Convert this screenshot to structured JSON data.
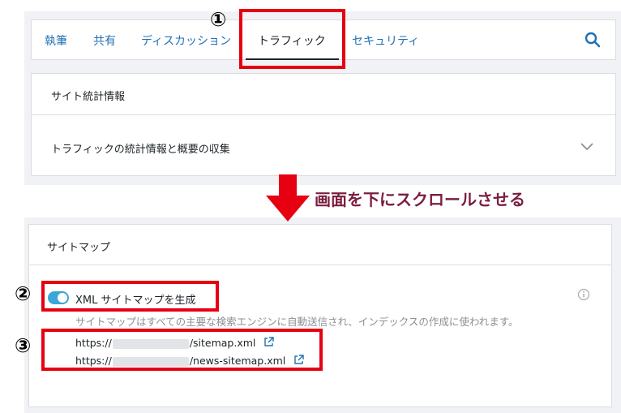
{
  "tabs": [
    {
      "label": "執筆"
    },
    {
      "label": "共有"
    },
    {
      "label": "ディスカッション"
    },
    {
      "label": "トラフィック",
      "active": true
    },
    {
      "label": "セキュリティ"
    }
  ],
  "site_stats": {
    "title": "サイト統計情報",
    "row_label": "トラフィックの統計情報と概要の収集"
  },
  "annotation": {
    "scroll_text": "画面を下にスクロールさせる",
    "markers": [
      "①",
      "②",
      "③"
    ]
  },
  "sitemap": {
    "title": "サイトマップ",
    "toggle_label": "XML サイトマップを生成",
    "toggle_on": true,
    "description": "サイトマップはすべての主要な検索エンジンに自動送信され、インデックスの作成に使われます。",
    "links": [
      {
        "prefix": "https://",
        "suffix": "/sitemap.xml"
      },
      {
        "prefix": "https://",
        "suffix": "/news-sitemap.xml"
      }
    ]
  },
  "colors": {
    "accent": "#3ba6d8",
    "link": "#2271b1",
    "annotation_red": "#e60012",
    "annotation_text": "#7a1f3d"
  }
}
